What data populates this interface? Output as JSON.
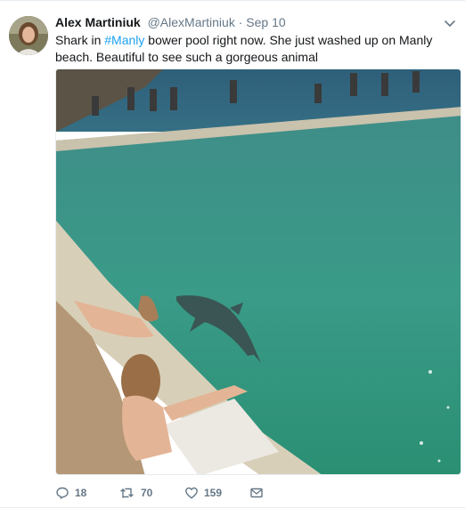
{
  "tweet": {
    "author_name": "Alex Martiniuk",
    "handle": "@AlexMartiniuk",
    "separator": "·",
    "timestamp": "Sep 10",
    "text_before": "Shark in ",
    "hashtag": "#Manly",
    "text_after": " bower pool right now. She just washed up on Manly beach. Beautiful to see such a gorgeous animal"
  },
  "actions": {
    "replies": "18",
    "retweets": "70",
    "likes": "159"
  },
  "colors": {
    "link": "#1da1f2",
    "muted": "#657786",
    "text": "#14171a"
  },
  "icons": [
    "reply-icon",
    "retweet-icon",
    "like-icon",
    "direct-message-icon",
    "chevron-down-icon"
  ]
}
